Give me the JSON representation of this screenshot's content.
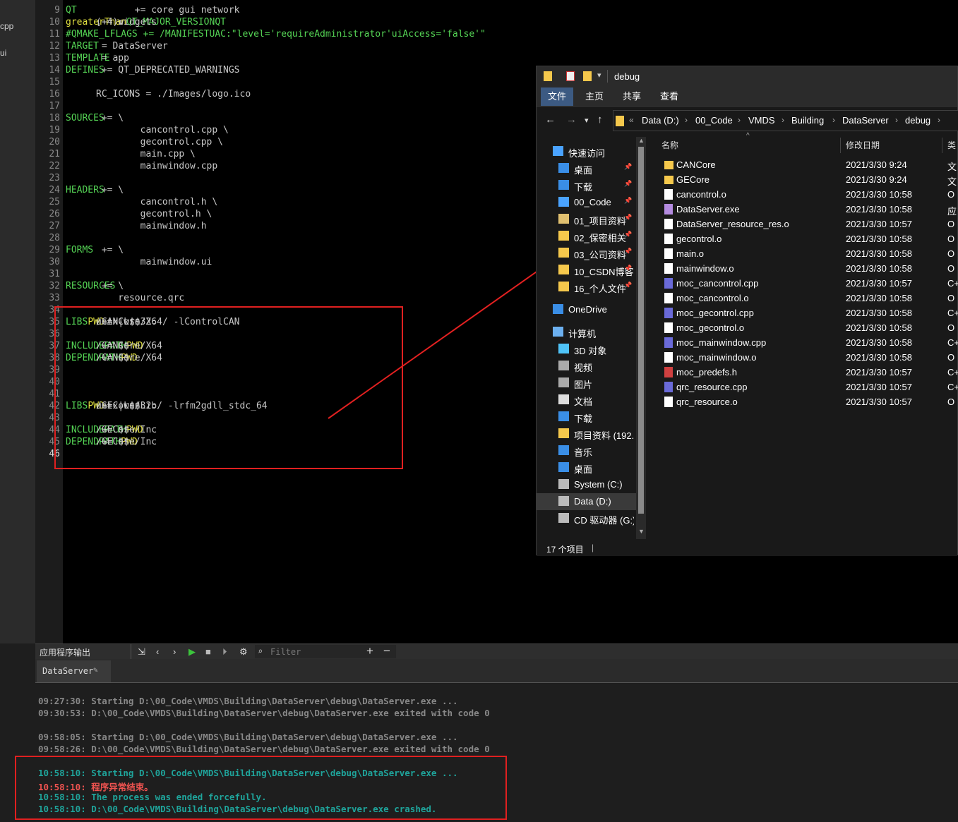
{
  "sidebar": {
    "items": [
      "cpp",
      "ui"
    ]
  },
  "editor": {
    "lines": [
      {
        "n": "9",
        "segs": [
          [
            "kw",
            "QT"
          ],
          [
            "txt",
            "       += core gui network"
          ]
        ]
      },
      {
        "n": "10",
        "segs": [
          [
            "var",
            "greaterThan"
          ],
          [
            "txt",
            "("
          ],
          [
            "kw",
            "QT_MAJOR_VERSION"
          ],
          [
            "txt",
            ", 4): "
          ],
          [
            "kw",
            "QT"
          ],
          [
            "txt",
            " += widgets"
          ]
        ]
      },
      {
        "n": "11",
        "segs": [
          [
            "cm",
            "#QMAKE_LFLAGS += /MANIFESTUAC:\"level='requireAdministrator'uiAccess='false'\""
          ]
        ]
      },
      {
        "n": "12",
        "segs": [
          [
            "kw",
            "TARGET"
          ],
          [
            "txt",
            " = DataServer"
          ]
        ]
      },
      {
        "n": "13",
        "segs": [
          [
            "kw",
            "TEMPLATE"
          ],
          [
            "txt",
            " = app"
          ]
        ]
      },
      {
        "n": "14",
        "segs": [
          [
            "kw",
            "DEFINES"
          ],
          [
            "txt",
            " += QT_DEPRECATED_WARNINGS"
          ]
        ]
      },
      {
        "n": "15",
        "segs": []
      },
      {
        "n": "16",
        "segs": [
          [
            "txt",
            "RC_ICONS = ./Images/logo.ico"
          ]
        ]
      },
      {
        "n": "17",
        "segs": []
      },
      {
        "n": "18",
        "segs": [
          [
            "kw",
            "SOURCES"
          ],
          [
            "txt",
            " += \\"
          ]
        ]
      },
      {
        "n": "19",
        "segs": [
          [
            "txt",
            "        cancontrol.cpp \\"
          ]
        ]
      },
      {
        "n": "20",
        "segs": [
          [
            "txt",
            "        gecontrol.cpp \\"
          ]
        ]
      },
      {
        "n": "21",
        "segs": [
          [
            "txt",
            "        main.cpp \\"
          ]
        ]
      },
      {
        "n": "22",
        "segs": [
          [
            "txt",
            "        mainwindow.cpp"
          ]
        ]
      },
      {
        "n": "23",
        "segs": []
      },
      {
        "n": "24",
        "segs": [
          [
            "kw",
            "HEADERS"
          ],
          [
            "txt",
            " += \\"
          ]
        ]
      },
      {
        "n": "25",
        "segs": [
          [
            "txt",
            "        cancontrol.h \\"
          ]
        ]
      },
      {
        "n": "26",
        "segs": [
          [
            "txt",
            "        gecontrol.h \\"
          ]
        ]
      },
      {
        "n": "27",
        "segs": [
          [
            "txt",
            "        mainwindow.h"
          ]
        ]
      },
      {
        "n": "28",
        "segs": []
      },
      {
        "n": "29",
        "segs": [
          [
            "kw",
            "FORMS"
          ],
          [
            "txt",
            " += \\"
          ]
        ]
      },
      {
        "n": "30",
        "segs": [
          [
            "txt",
            "        mainwindow.ui"
          ]
        ]
      },
      {
        "n": "31",
        "segs": []
      },
      {
        "n": "32",
        "segs": [
          [
            "kw",
            "RESOURCES"
          ],
          [
            "txt",
            " += \\"
          ]
        ]
      },
      {
        "n": "33",
        "segs": [
          [
            "txt",
            "    resource.qrc"
          ]
        ]
      },
      {
        "n": "34",
        "segs": []
      },
      {
        "n": "35",
        "segs": [
          [
            "txt",
            "unix|win32: "
          ],
          [
            "kw",
            "LIBS"
          ],
          [
            "txt",
            " += -L$$"
          ],
          [
            "var",
            "PWD"
          ],
          [
            "txt",
            "/CANCore/X64/ -lControlCAN"
          ]
        ]
      },
      {
        "n": "36",
        "segs": []
      },
      {
        "n": "37",
        "segs": [
          [
            "kw",
            "INCLUDEPATH"
          ],
          [
            "txt",
            " += $$"
          ],
          [
            "var",
            "PWD"
          ],
          [
            "txt",
            "/CANCore/X64"
          ]
        ]
      },
      {
        "n": "38",
        "segs": [
          [
            "kw",
            "DEPENDPATH"
          ],
          [
            "txt",
            " += $$"
          ],
          [
            "var",
            "PWD"
          ],
          [
            "txt",
            "/CANCore/X64"
          ]
        ]
      },
      {
        "n": "39",
        "segs": []
      },
      {
        "n": "40",
        "segs": []
      },
      {
        "n": "41",
        "segs": []
      },
      {
        "n": "42",
        "segs": [
          [
            "txt",
            "unix|win32: "
          ],
          [
            "kw",
            "LIBS"
          ],
          [
            "txt",
            " += -L$$"
          ],
          [
            "var",
            "PWD"
          ],
          [
            "txt",
            "/GECore/Lib/ -lrfm2gdll_stdc_64"
          ]
        ]
      },
      {
        "n": "43",
        "segs": []
      },
      {
        "n": "44",
        "segs": [
          [
            "kw",
            "INCLUDEPATH"
          ],
          [
            "txt",
            " += $$"
          ],
          [
            "var",
            "PWD"
          ],
          [
            "txt",
            "/GECore/Inc"
          ]
        ]
      },
      {
        "n": "45",
        "segs": [
          [
            "kw",
            "DEPENDPATH"
          ],
          [
            "txt",
            " += $$"
          ],
          [
            "var",
            "PWD"
          ],
          [
            "txt",
            "/GECore/Inc"
          ]
        ]
      },
      {
        "n": "46",
        "segs": []
      }
    ]
  },
  "explorer": {
    "title": "debug",
    "ribbon_tabs": [
      "文件",
      "主页",
      "共享",
      "查看"
    ],
    "breadcrumb": [
      "Data (D:)",
      "00_Code",
      "VMDS",
      "Building",
      "DataServer",
      "debug"
    ],
    "breadcrumb_prefix": "«",
    "nav": [
      {
        "label": "快速访问",
        "icon": "star-icon",
        "color": "#4aa3ff",
        "pin": false
      },
      {
        "label": "桌面",
        "icon": "desktop-icon",
        "color": "#3a8ee6",
        "pin": true
      },
      {
        "label": "下载",
        "icon": "download-icon",
        "color": "#3a8ee6",
        "pin": true
      },
      {
        "label": "00_Code",
        "icon": "star-folder-icon",
        "color": "#4aa3ff",
        "pin": true
      },
      {
        "label": "01_项目资料",
        "icon": "people-folder-icon",
        "color": "#e0c070",
        "pin": true
      },
      {
        "label": "02_保密相关",
        "icon": "folder-icon",
        "color": "#f5c84c",
        "pin": true
      },
      {
        "label": "03_公司资料",
        "icon": "folder-icon",
        "color": "#f5c84c",
        "pin": true
      },
      {
        "label": "10_CSDN博客",
        "icon": "folder-icon",
        "color": "#f5c84c",
        "pin": true
      },
      {
        "label": "16_个人文件",
        "icon": "lock-folder-icon",
        "color": "#f5c84c",
        "pin": true
      },
      {
        "label": "OneDrive",
        "icon": "cloud-icon",
        "color": "#3a8ee6",
        "pin": false
      },
      {
        "label": "计算机",
        "icon": "computer-icon",
        "color": "#6cb0f0",
        "pin": false
      },
      {
        "label": "3D 对象",
        "icon": "cube-icon",
        "color": "#4fc3f7",
        "pin": false
      },
      {
        "label": "视频",
        "icon": "video-icon",
        "color": "#aaaaaa",
        "pin": false
      },
      {
        "label": "图片",
        "icon": "picture-icon",
        "color": "#aaaaaa",
        "pin": false
      },
      {
        "label": "文档",
        "icon": "document-icon",
        "color": "#dddddd",
        "pin": false
      },
      {
        "label": "下载",
        "icon": "download-icon",
        "color": "#3a8ee6",
        "pin": false
      },
      {
        "label": "项目资料 (192.1",
        "icon": "network-folder-icon",
        "color": "#f5c84c",
        "pin": false
      },
      {
        "label": "音乐",
        "icon": "music-icon",
        "color": "#3a8ee6",
        "pin": false
      },
      {
        "label": "桌面",
        "icon": "desktop-icon",
        "color": "#3a8ee6",
        "pin": false
      },
      {
        "label": "System (C:)",
        "icon": "drive-icon",
        "color": "#bbbbbb",
        "pin": false
      },
      {
        "label": "Data (D:)",
        "icon": "drive-icon",
        "color": "#bbbbbb",
        "pin": false,
        "selected": true
      },
      {
        "label": "CD 驱动器 (G:)",
        "icon": "cd-drive-icon",
        "color": "#bbbbbb",
        "pin": false
      }
    ],
    "columns": {
      "name": "名称",
      "date": "修改日期",
      "type": "类"
    },
    "files": [
      {
        "name": "CANCore",
        "date": "2021/3/30 9:24",
        "type": "文",
        "icon": "folder-icon",
        "color": "#f5c84c"
      },
      {
        "name": "GECore",
        "date": "2021/3/30 9:24",
        "type": "文",
        "icon": "folder-icon",
        "color": "#f5c84c"
      },
      {
        "name": "cancontrol.o",
        "date": "2021/3/30 10:58",
        "type": "O",
        "icon": "file-icon",
        "color": "#ffffff"
      },
      {
        "name": "DataServer.exe",
        "date": "2021/3/30 10:58",
        "type": "应",
        "icon": "exe-icon",
        "color": "#b48be0"
      },
      {
        "name": "DataServer_resource_res.o",
        "date": "2021/3/30 10:57",
        "type": "O",
        "icon": "file-icon",
        "color": "#ffffff"
      },
      {
        "name": "gecontrol.o",
        "date": "2021/3/30 10:58",
        "type": "O",
        "icon": "file-icon",
        "color": "#ffffff"
      },
      {
        "name": "main.o",
        "date": "2021/3/30 10:58",
        "type": "O",
        "icon": "file-icon",
        "color": "#ffffff"
      },
      {
        "name": "mainwindow.o",
        "date": "2021/3/30 10:58",
        "type": "O",
        "icon": "file-icon",
        "color": "#ffffff"
      },
      {
        "name": "moc_cancontrol.cpp",
        "date": "2021/3/30 10:57",
        "type": "C+",
        "icon": "cpp-file-icon",
        "color": "#6a6ad8"
      },
      {
        "name": "moc_cancontrol.o",
        "date": "2021/3/30 10:58",
        "type": "O",
        "icon": "file-icon",
        "color": "#ffffff"
      },
      {
        "name": "moc_gecontrol.cpp",
        "date": "2021/3/30 10:58",
        "type": "C+",
        "icon": "cpp-file-icon",
        "color": "#6a6ad8"
      },
      {
        "name": "moc_gecontrol.o",
        "date": "2021/3/30 10:58",
        "type": "O",
        "icon": "file-icon",
        "color": "#ffffff"
      },
      {
        "name": "moc_mainwindow.cpp",
        "date": "2021/3/30 10:58",
        "type": "C+",
        "icon": "cpp-file-icon",
        "color": "#6a6ad8"
      },
      {
        "name": "moc_mainwindow.o",
        "date": "2021/3/30 10:58",
        "type": "O",
        "icon": "file-icon",
        "color": "#ffffff"
      },
      {
        "name": "moc_predefs.h",
        "date": "2021/3/30 10:57",
        "type": "C+",
        "icon": "h-file-icon",
        "color": "#d04040"
      },
      {
        "name": "qrc_resource.cpp",
        "date": "2021/3/30 10:57",
        "type": "C+",
        "icon": "cpp-file-icon",
        "color": "#6a6ad8"
      },
      {
        "name": "qrc_resource.o",
        "date": "2021/3/30 10:57",
        "type": "O",
        "icon": "file-icon",
        "color": "#ffffff"
      }
    ],
    "status": "17 个项目"
  },
  "output": {
    "panel_label": "应用程序输出",
    "filter_placeholder": "Filter",
    "tab_label": "DataServer",
    "lines": [
      {
        "cls": "gray",
        "text": "09:27:30: Starting D:\\00_Code\\VMDS\\Building\\DataServer\\debug\\DataServer.exe ..."
      },
      {
        "cls": "gray",
        "text": "09:30:53: D:\\00_Code\\VMDS\\Building\\DataServer\\debug\\DataServer.exe exited with code 0"
      },
      {
        "cls": "gray",
        "text": ""
      },
      {
        "cls": "gray",
        "text": "09:58:05: Starting D:\\00_Code\\VMDS\\Building\\DataServer\\debug\\DataServer.exe ..."
      },
      {
        "cls": "gray",
        "text": "09:58:26: D:\\00_Code\\VMDS\\Building\\DataServer\\debug\\DataServer.exe exited with code 0"
      },
      {
        "cls": "gray",
        "text": ""
      },
      {
        "cls": "teal",
        "text": "10:58:10: Starting D:\\00_Code\\VMDS\\Building\\DataServer\\debug\\DataServer.exe ..."
      },
      {
        "cls": "red",
        "text": "10:58:10: 程序异常结束。"
      },
      {
        "cls": "teal",
        "text": "10:58:10: The process was ended forcefully."
      },
      {
        "cls": "teal",
        "text": "10:58:10: D:\\00_Code\\VMDS\\Building\\DataServer\\debug\\DataServer.exe crashed."
      }
    ]
  },
  "colors": {
    "annotation_red": "#e02020",
    "crash_red": "#ef5350",
    "info_teal": "#1fa49b"
  }
}
